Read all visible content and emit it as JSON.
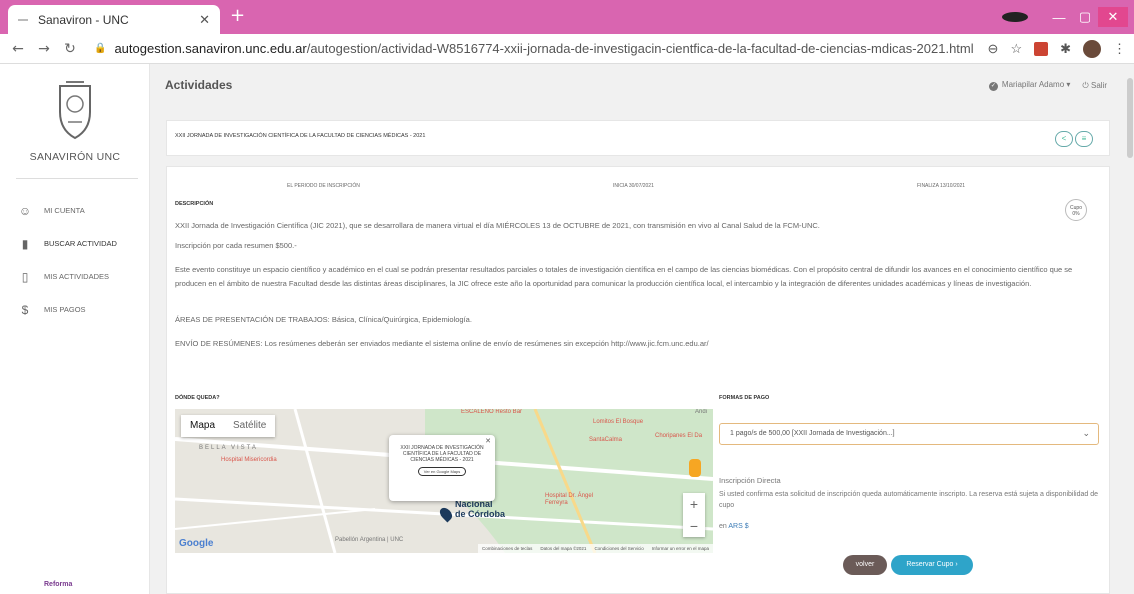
{
  "browser": {
    "tab_title": "Sanaviron - UNC",
    "url_domain": "autogestion.sanaviron.unc.edu.ar",
    "url_path": "/autogestion/actividad-W8516774-xxii-jornada-de-investigacin-cientfica-de-la-facultad-de-ciencias-mdicas-2021.html"
  },
  "sidebar": {
    "brand": "SANAVIRÓN UNC",
    "items": [
      {
        "label": "MI CUENTA"
      },
      {
        "label": "BUSCAR ACTIVIDAD"
      },
      {
        "label": "MIS ACTIVIDADES"
      },
      {
        "label": "MIS PAGOS"
      }
    ],
    "footer_logo": "Reforma"
  },
  "header": {
    "title": "Actividades",
    "user": "Mariapilar Adamo",
    "logout": "Salir"
  },
  "activity": {
    "title": "XXII JORNADA DE INVESTIGACIÓN CIENTÍFICA DE LA FACULTAD DE CIENCIAS MÉDICAS - 2021",
    "period_label": "EL PERIODO DE INSCRIPCIÓN",
    "start": "INICIA 30/07/2021",
    "end": "FINALIZA 13/10/2021",
    "cupo_label": "Cupo",
    "cupo_value": "0%",
    "desc_heading": "DESCRIPCIÓN",
    "p1": "XXII Jornada de Investigación Científica (JIC 2021), que se desarrollara de manera virtual el día MIÉRCOLES 13 de OCTUBRE de 2021, con transmisión en vivo al Canal Salud de la FCM-UNC.",
    "p2": "Inscripción por cada resumen $500.-",
    "p3": "Este evento constituye un espacio científico y académico en el cual se podrán presentar resultados parciales o totales de investigación científica en el campo de las ciencias biomédicas. Con el propósito central de difundir los avances en el conocimiento científico que se producen en el ámbito de nuestra Facultad desde las distintas áreas disciplinares, la JIC ofrece este año la oportunidad para comunicar la producción científica local, el intercambio y la integración de diferentes unidades académicas y líneas de investigación.",
    "p4": "ÁREAS DE PRESENTACIÓN DE TRABAJOS: Básica, Clínica/Quirúrgica, Epidemiología.",
    "p5": "ENVÍO DE RESÚMENES: Los resúmenes deberán ser enviados mediante el sistema online de envío de resúmenes sin excepción http://www.jic.fcm.unc.edu.ar/",
    "where_heading": "DÓNDE QUEDA?",
    "pay_heading": "FORMAS DE PAGO",
    "pay_option": "1 pago/s de 500,00 [XXII Jornada de Investigación...]",
    "insc_title": "Inscripción Directa",
    "insc_text": "Si usted confirma esta solicitud de inscripción queda automáticamente inscripto. La reserva está sujeta a disponibilidad de cupo",
    "currency_prefix": "en",
    "currency": "ARS $",
    "btn_back": "volver",
    "btn_reserve": "Reservar Cupo"
  },
  "map": {
    "tab_map": "Mapa",
    "tab_sat": "Satélite",
    "popup_title": "XXII JORNADA DE INVESTIGACIÓN CIENTÍFICA DE LA FACULTAD DE CIENCIAS MÉDICAS - 2021",
    "popup_link": "Ver en Google Maps",
    "labels": {
      "bella": "BELLA VISTA",
      "hosp_mis": "Hospital Misericordia",
      "escaleno": "ESCALENO Resto Bar",
      "lomitos": "Lomitos El Bosque",
      "santa": "SantaCalma",
      "choripanes": "Choripanes El Da",
      "hosp_ferreyra": "Hospital Dr. Ángel Ferreyra",
      "nacional": "Nacional",
      "cordoba": "de Córdoba",
      "pabellon": "Pabellón Argentina | UNC",
      "andi": "Andi"
    },
    "footer": [
      "Combinaciones de teclas",
      "Datos del mapa ©2021",
      "Condiciones del Servicio",
      "Informar un error en el mapa"
    ],
    "google": "Google"
  }
}
